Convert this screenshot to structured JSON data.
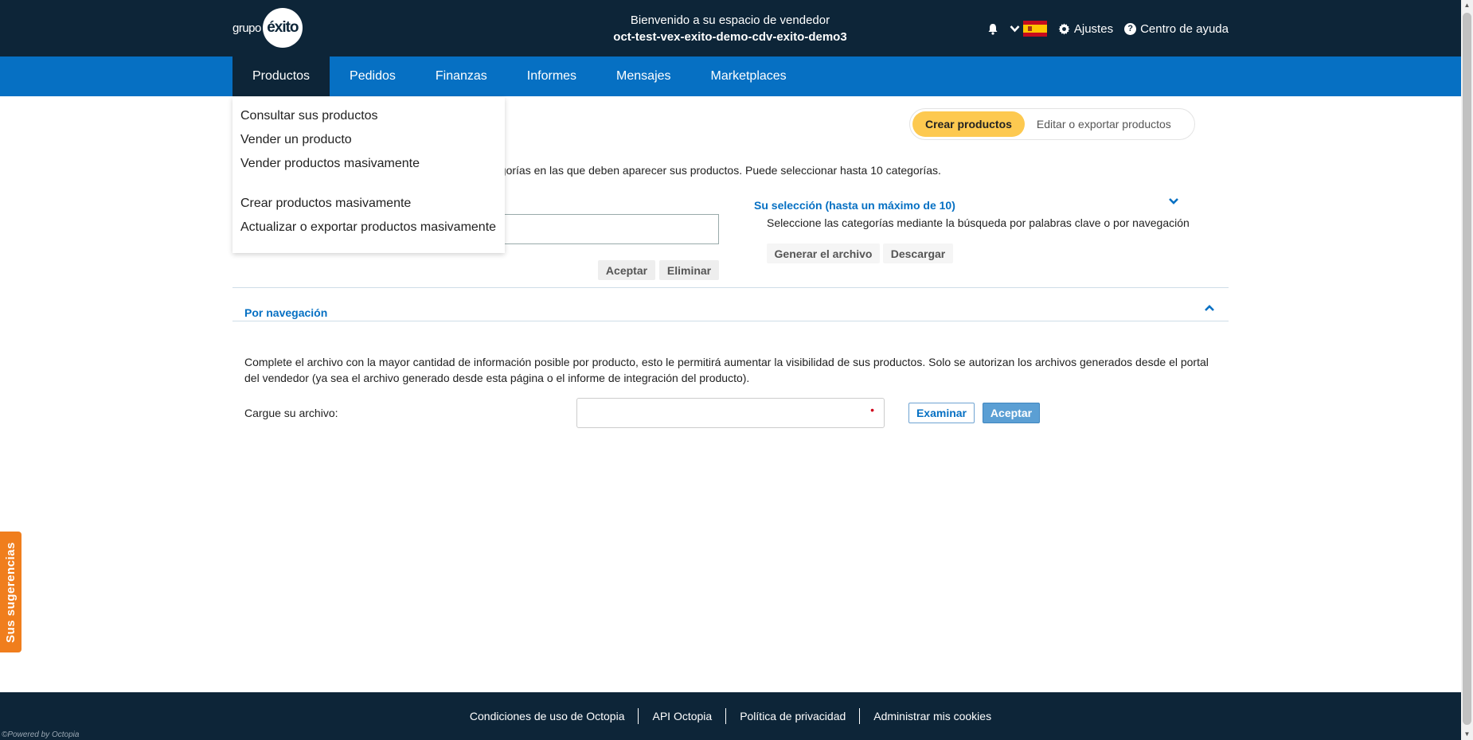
{
  "header": {
    "logo_prefix": "grupo",
    "logo_mark": "éxito",
    "welcome_line": "Bienvenido a su espacio de vendedor",
    "shop_name": "oct-test-vex-exito-demo-cdv-exito-demo3",
    "bell_icon": "bell-icon",
    "language_flag": "spain-flag",
    "settings_label": "Ajustes",
    "help_label": "Centro de ayuda"
  },
  "nav": {
    "tabs": [
      {
        "label": "Productos",
        "active": true
      },
      {
        "label": "Pedidos"
      },
      {
        "label": "Finanzas"
      },
      {
        "label": "Informes"
      },
      {
        "label": "Mensajes"
      },
      {
        "label": "Marketplaces"
      }
    ]
  },
  "dropdown": {
    "group1": [
      "Consultar sus productos",
      "Vender un producto",
      "Vender productos masivamente"
    ],
    "group2": [
      "Crear productos masivamente",
      "Actualizar o exportar productos masivamente"
    ]
  },
  "mode": {
    "active": "Crear productos",
    "inactive": "Editar o exportar productos"
  },
  "categories": {
    "intro": "egorías en las que deben aparecer sus productos. Puede seleccionar hasta 10 categorías.",
    "accept_label": "Aceptar",
    "delete_label": "Eliminar",
    "selection_title": "Su selección (hasta un máximo de 10)",
    "selection_hint": "Seleccione las categorías mediante la búsqueda por palabras clave o por navegación",
    "generate_label": "Generar el archivo",
    "download_label": "Descargar",
    "browse_title": "Por navegación"
  },
  "upload": {
    "description": "Complete el archivo con la mayor cantidad de información posible por producto, esto le permitirá aumentar la visibilidad de sus productos. Solo se autorizan los archivos generados desde el portal del vendedor (ya sea el archivo generado desde esta página o el informe de integración del producto).",
    "label": "Cargue su archivo:",
    "required_mark": "•",
    "browse_label": "Examinar",
    "accept_label": "Aceptar"
  },
  "suggestions_label": "Sus sugerencias",
  "footer": {
    "links": [
      "Condiciones de uso de Octopia",
      "API Octopia",
      "Política de privacidad",
      "Administrar mis cookies"
    ],
    "powered": "©Powered by Octopia"
  },
  "colors": {
    "dark": "#0d2538",
    "primary": "#0670c3",
    "accent": "#fdc950",
    "suggest": "#f07e1d"
  }
}
